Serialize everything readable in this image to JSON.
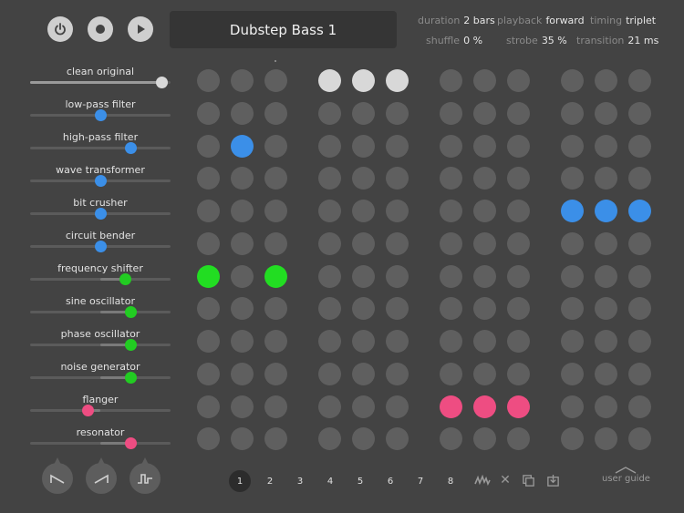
{
  "transport": {
    "buttons": [
      {
        "name": "power-button",
        "icon": "power-icon"
      },
      {
        "name": "record-button",
        "icon": "record-icon"
      },
      {
        "name": "play-button",
        "icon": "play-icon"
      }
    ]
  },
  "preset": {
    "name": "Dubstep Bass 1"
  },
  "params": {
    "duration": {
      "key": "duration",
      "value": "2 bars"
    },
    "playback": {
      "key": "playback",
      "value": "forward"
    },
    "timing": {
      "key": "timing",
      "value": "triplet"
    },
    "shuffle": {
      "key": "shuffle",
      "value": "0 %"
    },
    "strobe": {
      "key": "strobe",
      "value": "35 %"
    },
    "transition": {
      "key": "transition",
      "value": "21 ms"
    }
  },
  "effects": [
    {
      "label": "clean original",
      "value": 0.94,
      "color": "#d8d8d8",
      "fill": "left"
    },
    {
      "label": "low-pass filter",
      "value": 0.5,
      "color": "#3b8fe8",
      "fill": "none"
    },
    {
      "label": "high-pass filter",
      "value": 0.72,
      "color": "#3b8fe8",
      "fill": "none"
    },
    {
      "label": "wave transformer",
      "value": 0.5,
      "color": "#3b8fe8",
      "fill": "none"
    },
    {
      "label": "bit crusher",
      "value": 0.5,
      "color": "#3b8fe8",
      "fill": "none"
    },
    {
      "label": "circuit bender",
      "value": 0.5,
      "color": "#3b8fe8",
      "fill": "none"
    },
    {
      "label": "frequency shifter",
      "value": 0.68,
      "color": "#22cc22",
      "fill": "center"
    },
    {
      "label": "sine oscillator",
      "value": 0.72,
      "color": "#22cc22",
      "fill": "center"
    },
    {
      "label": "phase oscillator",
      "value": 0.72,
      "color": "#22cc22",
      "fill": "center"
    },
    {
      "label": "noise generator",
      "value": 0.72,
      "color": "#22cc22",
      "fill": "center"
    },
    {
      "label": "flanger",
      "value": 0.41,
      "color": "#ee4d82",
      "fill": "center"
    },
    {
      "label": "resonator",
      "value": 0.72,
      "color": "#ee4d82",
      "fill": "center"
    }
  ],
  "pad_colors": {
    "off": "#5f5f5f",
    "white": "#d8d8d8",
    "blue": "#3b8fe8",
    "green": "#22dd22",
    "pink": "#ee4d82"
  },
  "active_pads": [
    {
      "row": 0,
      "col": 3,
      "color": "white"
    },
    {
      "row": 0,
      "col": 4,
      "color": "white"
    },
    {
      "row": 0,
      "col": 5,
      "color": "white"
    },
    {
      "row": 2,
      "col": 1,
      "color": "blue"
    },
    {
      "row": 4,
      "col": 9,
      "color": "blue"
    },
    {
      "row": 4,
      "col": 10,
      "color": "blue"
    },
    {
      "row": 4,
      "col": 11,
      "color": "blue"
    },
    {
      "row": 6,
      "col": 0,
      "color": "green"
    },
    {
      "row": 6,
      "col": 2,
      "color": "green"
    },
    {
      "row": 10,
      "col": 6,
      "color": "pink"
    },
    {
      "row": 10,
      "col": 7,
      "color": "pink"
    },
    {
      "row": 10,
      "col": 8,
      "color": "pink"
    }
  ],
  "envelopes": [
    {
      "name": "envelope-decay",
      "icon": "decay-envelope-icon"
    },
    {
      "name": "envelope-attack",
      "icon": "attack-envelope-icon"
    },
    {
      "name": "envelope-gate",
      "icon": "gate-envelope-icon"
    }
  ],
  "pages": {
    "labels": [
      "1",
      "2",
      "3",
      "4",
      "5",
      "6",
      "7",
      "8"
    ],
    "active": 0
  },
  "tools": [
    {
      "name": "randomize",
      "icon": "waveform-icon"
    },
    {
      "name": "clear",
      "icon": "close-icon",
      "glyph": "✕"
    },
    {
      "name": "copy",
      "icon": "copy-icon"
    },
    {
      "name": "paste",
      "icon": "paste-icon"
    }
  ],
  "guide": {
    "label": "user guide"
  }
}
